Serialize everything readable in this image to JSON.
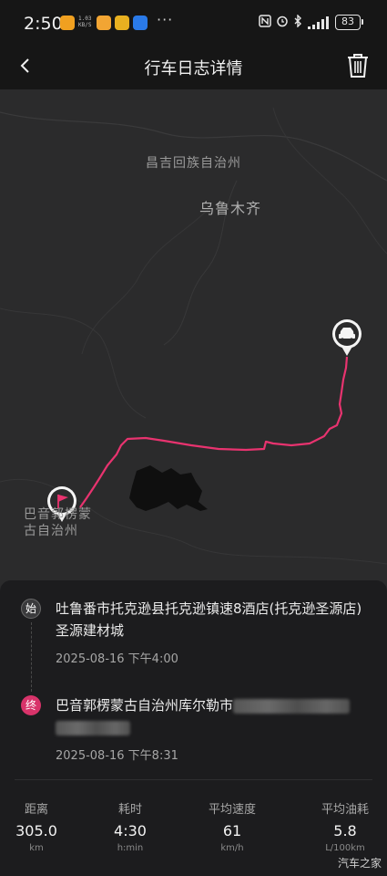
{
  "status_bar": {
    "time": "2:50",
    "net_speed": "1.03 KB/S",
    "more": "···",
    "battery": "83"
  },
  "header": {
    "title": "行车日志详情"
  },
  "map": {
    "labels": {
      "changji": "昌吉回族自治州",
      "urumqi": "乌鲁木齐",
      "bayingolin": "巴音郭楞蒙古自治州"
    }
  },
  "trip": {
    "start": {
      "badge": "始",
      "address": "吐鲁番市托克逊县托克逊镇速8酒店(托克逊圣源店)圣源建材城",
      "time": "2025-08-16 下午4:00"
    },
    "end": {
      "badge": "终",
      "address": "巴音郭楞蒙古自治州库尔勒市",
      "time": "2025-08-16 下午8:31"
    }
  },
  "stats": [
    {
      "label": "距离",
      "value": "305.0",
      "unit": "km"
    },
    {
      "label": "耗时",
      "value": "4:30",
      "unit": "h:min"
    },
    {
      "label": "平均速度",
      "value": "61",
      "unit": "km/h"
    },
    {
      "label": "平均油耗",
      "value": "5.8",
      "unit": "L/100km"
    }
  ],
  "watermark": "汽车之家",
  "colors": {
    "route": "#e8336f",
    "end_badge": "#d8336a",
    "map_bg": "#2b2b2c",
    "sheet_bg": "#1c1c1e"
  }
}
